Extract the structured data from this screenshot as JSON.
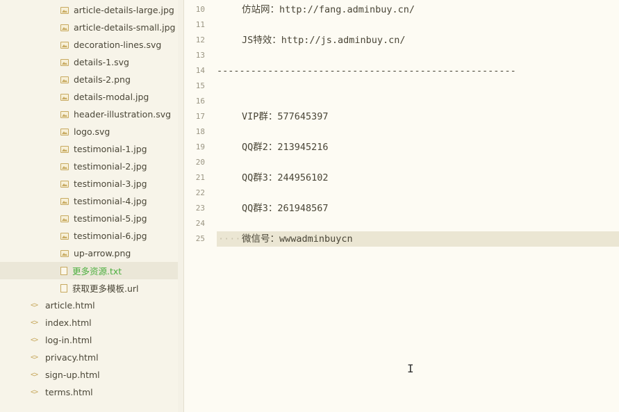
{
  "sidebar": {
    "files": [
      {
        "label": "article-details-large.jpg",
        "icon": "image-file-icon"
      },
      {
        "label": "article-details-small.jpg",
        "icon": "image-file-icon"
      },
      {
        "label": "decoration-lines.svg",
        "icon": "image-file-icon"
      },
      {
        "label": "details-1.svg",
        "icon": "image-file-icon"
      },
      {
        "label": "details-2.png",
        "icon": "image-file-icon"
      },
      {
        "label": "details-modal.jpg",
        "icon": "image-file-icon"
      },
      {
        "label": "header-illustration.svg",
        "icon": "image-file-icon"
      },
      {
        "label": "logo.svg",
        "icon": "image-file-icon"
      },
      {
        "label": "testimonial-1.jpg",
        "icon": "image-file-icon"
      },
      {
        "label": "testimonial-2.jpg",
        "icon": "image-file-icon"
      },
      {
        "label": "testimonial-3.jpg",
        "icon": "image-file-icon"
      },
      {
        "label": "testimonial-4.jpg",
        "icon": "image-file-icon"
      },
      {
        "label": "testimonial-5.jpg",
        "icon": "image-file-icon"
      },
      {
        "label": "testimonial-6.jpg",
        "icon": "image-file-icon"
      },
      {
        "label": "up-arrow.png",
        "icon": "image-file-icon"
      },
      {
        "label": "更多资源.txt",
        "icon": "text-file-icon",
        "selected": true
      },
      {
        "label": "获取更多模板.url",
        "icon": "text-file-icon"
      }
    ],
    "html_files": [
      {
        "label": "article.html",
        "icon": "code-file-icon"
      },
      {
        "label": "index.html",
        "icon": "code-file-icon"
      },
      {
        "label": "log-in.html",
        "icon": "code-file-icon"
      },
      {
        "label": "privacy.html",
        "icon": "code-file-icon"
      },
      {
        "label": "sign-up.html",
        "icon": "code-file-icon"
      },
      {
        "label": "terms.html",
        "icon": "code-file-icon"
      }
    ],
    "selected_color": "#4caf3f"
  },
  "editor": {
    "lines": [
      {
        "n": "10",
        "text": "仿站网：http://fang.adminbuy.cn/"
      },
      {
        "n": "11",
        "text": ""
      },
      {
        "n": "12",
        "text": "JS特效：http://js.adminbuy.cn/"
      },
      {
        "n": "13",
        "text": ""
      },
      {
        "n": "14",
        "text": "-----------------------------------------------------"
      },
      {
        "n": "15",
        "text": ""
      },
      {
        "n": "16",
        "text": ""
      },
      {
        "n": "17",
        "text": "VIP群：577645397"
      },
      {
        "n": "18",
        "text": ""
      },
      {
        "n": "19",
        "text": "QQ群2：213945216"
      },
      {
        "n": "20",
        "text": ""
      },
      {
        "n": "21",
        "text": "QQ群3：244956102"
      },
      {
        "n": "22",
        "text": ""
      },
      {
        "n": "23",
        "text": "QQ群3：261948567"
      },
      {
        "n": "24",
        "text": ""
      },
      {
        "n": "25",
        "text": "微信号：wwwadminbuycn",
        "current": true
      }
    ],
    "current_line_color": "#ebe6d3"
  },
  "cursor_icon": "text-cursor-icon"
}
